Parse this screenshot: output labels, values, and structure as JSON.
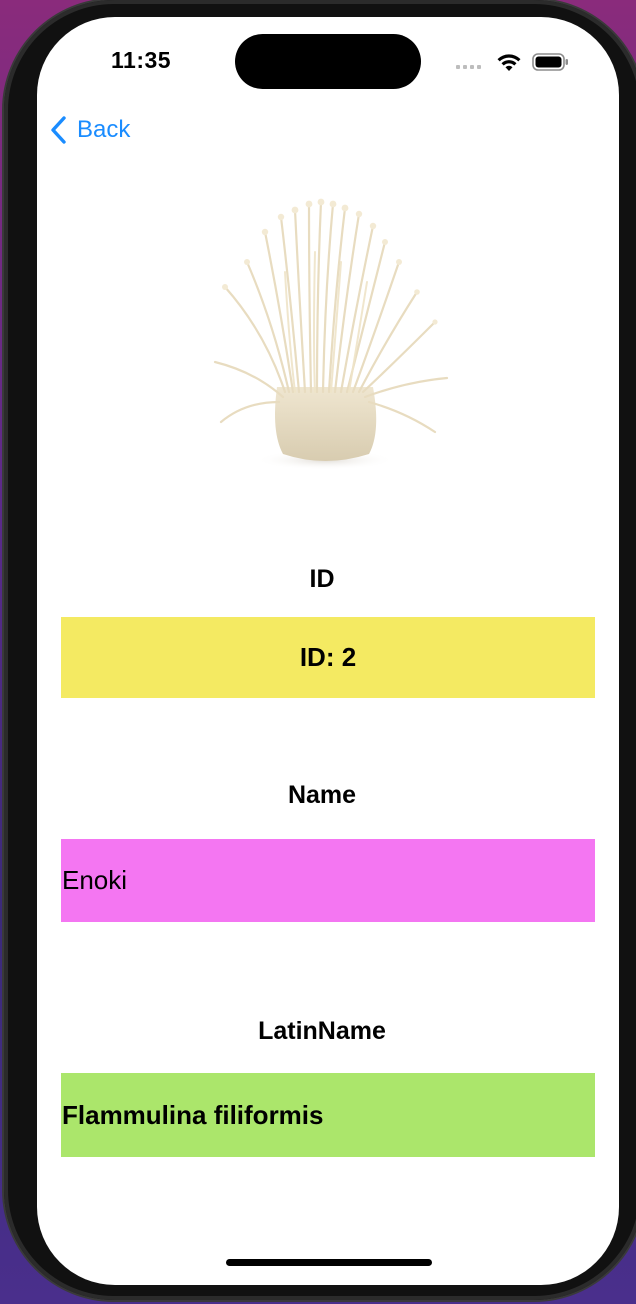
{
  "status_bar": {
    "time": "11:35",
    "icons": [
      "signal-icon",
      "wifi-icon",
      "battery-icon"
    ]
  },
  "nav": {
    "back_label": "Back",
    "back_icon": "chevron-left-icon"
  },
  "detail": {
    "image": "enoki-mushroom-image",
    "id_label": "ID",
    "id_value": "ID: 2",
    "name_label": "Name",
    "name_value": "Enoki",
    "latin_label": "LatinName",
    "latin_value": "Flammulina filiformis"
  },
  "colors": {
    "accent": "#1a8cff",
    "id_background": "#f4ea62",
    "name_background": "#f476f2",
    "latin_background": "#abe66b"
  }
}
